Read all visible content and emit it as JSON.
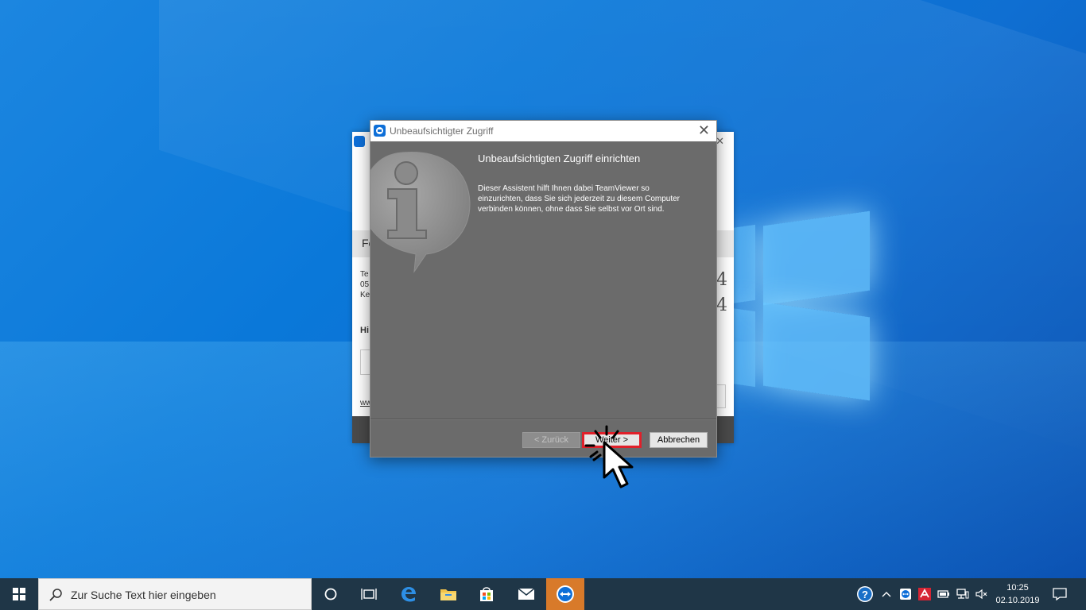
{
  "dialog": {
    "title": "Unbeaufsichtigter Zugriff",
    "close_glyph": "✕",
    "heading": "Unbeaufsichtigten Zugriff einrichten",
    "description": "Dieser Assistent hilft Ihnen dabei TeamViewer so einzurichten, dass Sie sich jederzeit zu diesem Computer verbinden können, ohne dass Sie selbst vor Ort sind.",
    "back_label": "< Zurück",
    "next_label": "Weiter >",
    "cancel_label": "Abbrechen",
    "highlight_color": "#e0202a"
  },
  "background_window": {
    "header_partial": "Fe",
    "lines": [
      "Te",
      "05",
      "Ke"
    ],
    "bold_partial": "Hi",
    "link_partial": "ww",
    "right_top": "74",
    "right_bottom": "4"
  },
  "taskbar": {
    "search_placeholder": "Zur Suche Text hier eingeben",
    "icons": [
      "cortana-icon",
      "task-view-icon",
      "edge-icon",
      "file-explorer-icon",
      "store-icon",
      "mail-icon",
      "teamviewer-icon"
    ],
    "active_app": "teamviewer-icon",
    "time": "10:25",
    "date": "02.10.2019",
    "active_color": "#d87a2a"
  }
}
